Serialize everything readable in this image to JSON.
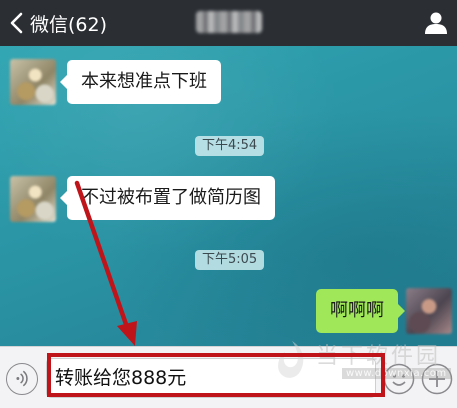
{
  "navbar": {
    "back_label": "微信(62)",
    "icons": {
      "back": "chevron-left-icon",
      "contact": "person-icon"
    }
  },
  "messages": [
    {
      "type": "received",
      "text": "本来想准点下班"
    },
    {
      "type": "time",
      "text": "下午4:54"
    },
    {
      "type": "received",
      "text": "不过被布置了做简历图"
    },
    {
      "type": "time",
      "text": "下午5:05"
    },
    {
      "type": "sent",
      "text": "啊啊啊"
    }
  ],
  "input": {
    "value": "转账给您888元"
  },
  "watermark": {
    "text": "当下软件园",
    "url": "www.downxia.com"
  },
  "colors": {
    "navbar": "#2b2f34",
    "chat_bg": "#2a9aa8",
    "bubble_in": "#ffffff",
    "bubble_out": "#a0e75a",
    "annotation": "#c0141b"
  }
}
